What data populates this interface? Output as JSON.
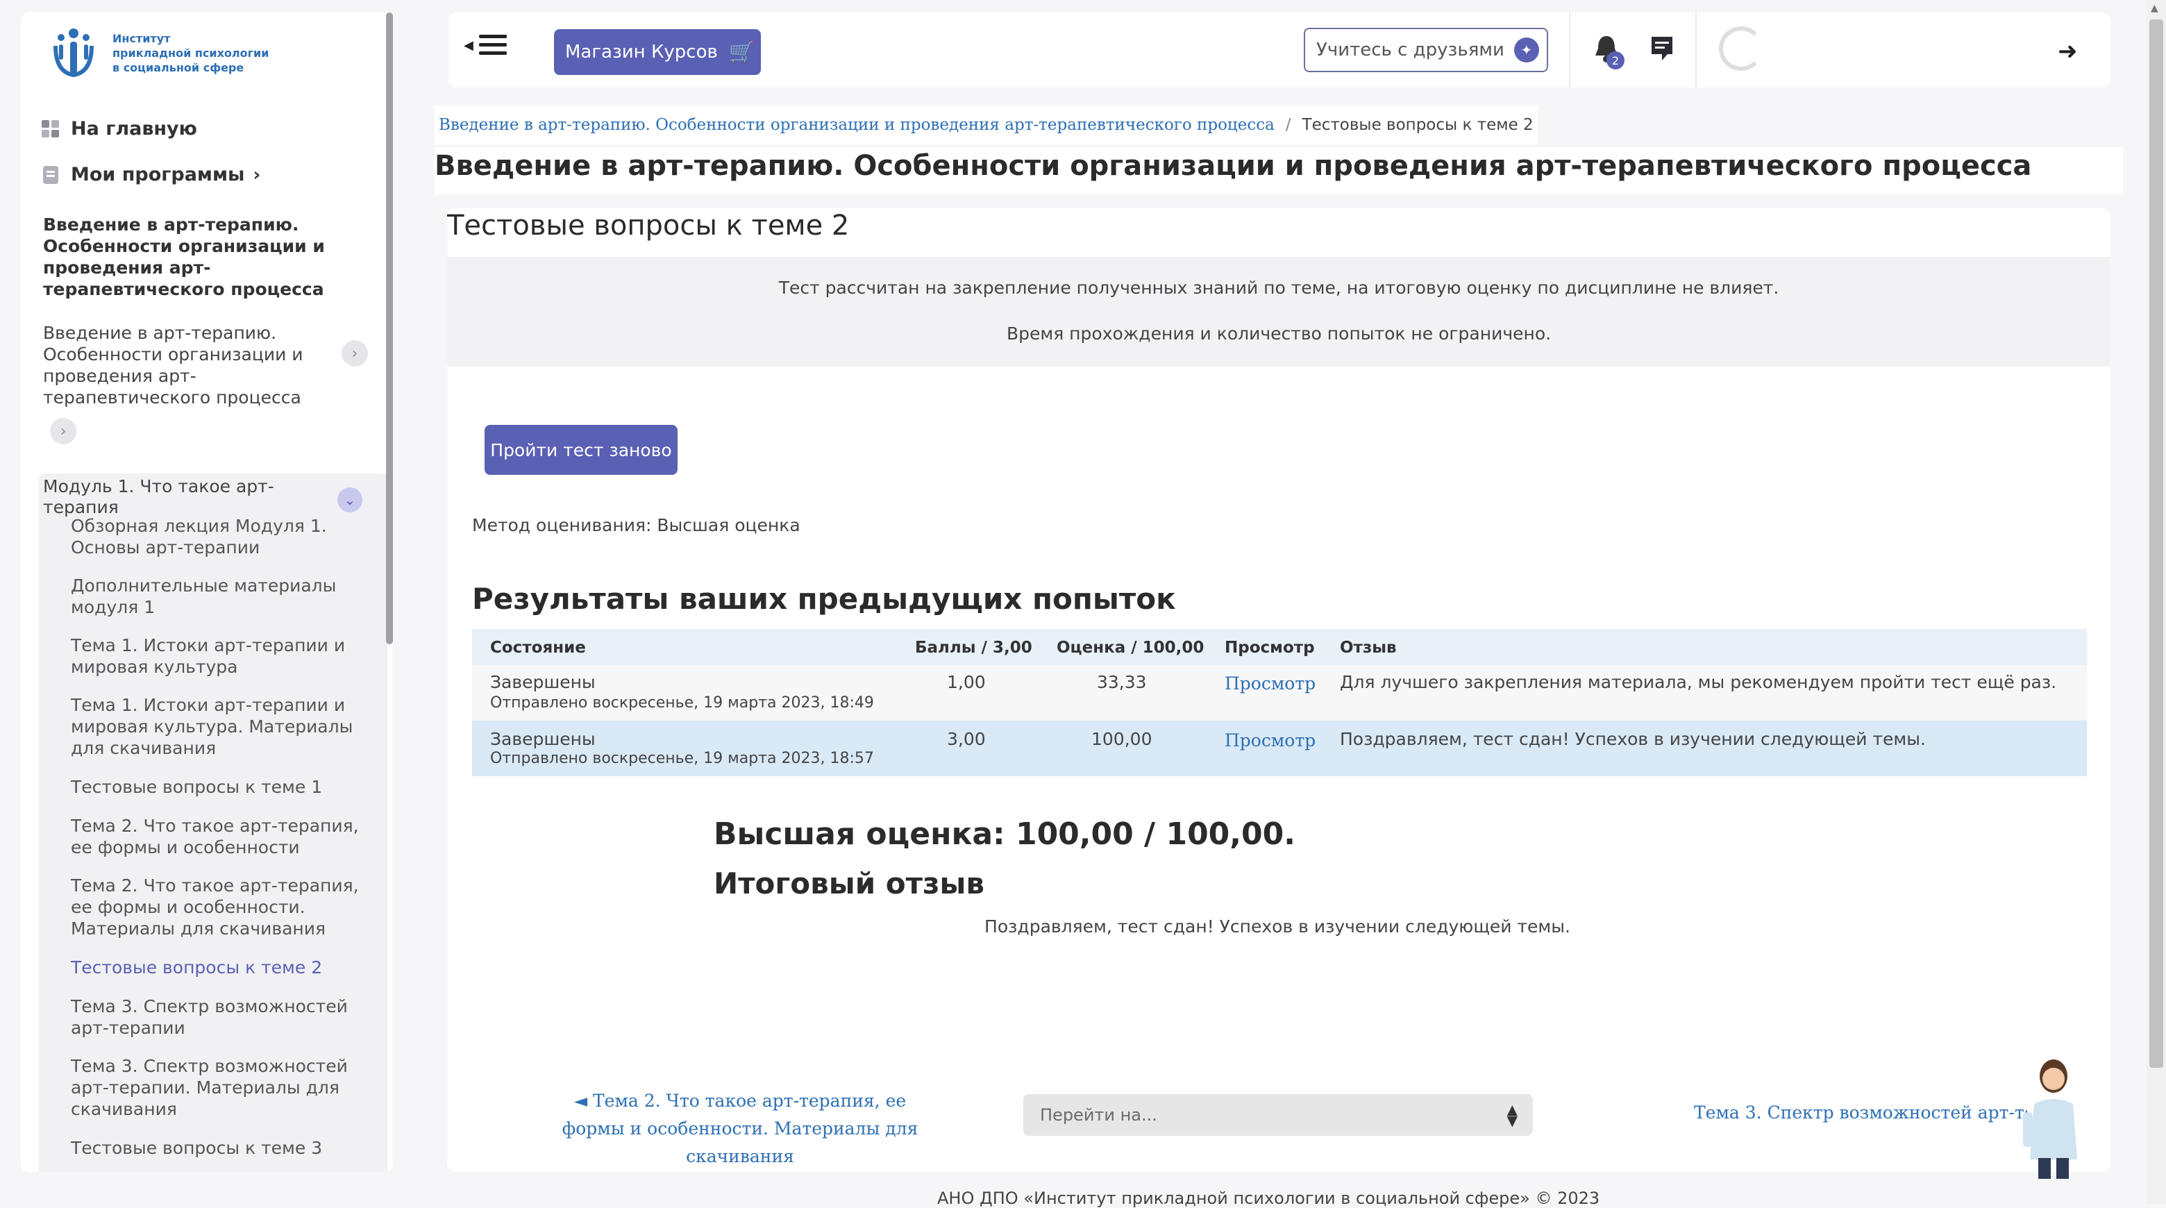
{
  "sidebar": {
    "logo_lines": [
      "Институт",
      "прикладной психологии",
      "в социальной сфере"
    ],
    "home_label": "На главную",
    "programs_label": "Мои программы",
    "course_title": "Введение в арт-терапию. Особенности организации и проведения арт-терапевтического процесса",
    "course_sub": "Введение в арт-терапию. Особенности организации и проведения арт-терапевтического процесса",
    "module_title": "Модуль 1. Что такое арт-терапия",
    "items": [
      {
        "label": "Обзорная лекция Модуля 1. Основы арт-терапии"
      },
      {
        "label": "Дополнительные материалы модуля 1"
      },
      {
        "label": "Тема 1. Истоки арт-терапии и мировая культура"
      },
      {
        "label": "Тема 1. Истоки арт-терапии и мировая культура. Материалы для скачивания"
      },
      {
        "label": "Тестовые вопросы к теме 1"
      },
      {
        "label": "Тема 2. Что такое арт-терапия, ее формы и особенности"
      },
      {
        "label": "Тема 2. Что такое арт-терапия, ее формы и особенности. Материалы для скачивания"
      },
      {
        "label": "Тестовые вопросы к теме 2",
        "active": true
      },
      {
        "label": "Тема 3. Спектр возможностей арт-терапии"
      },
      {
        "label": "Тема 3. Спектр возможностей арт-терапии. Материалы для скачивания"
      },
      {
        "label": "Тестовые вопросы к теме 3"
      }
    ]
  },
  "topbar": {
    "shop_label": "Магазин Курсов",
    "friends_label": "Учитесь с друзьями",
    "notif_count": "2"
  },
  "breadcrumb": {
    "course": "Введение в арт-терапию. Особенности организации и проведения арт-терапевтического процесса",
    "sep": "/",
    "current": "Тестовые вопросы к теме 2"
  },
  "page": {
    "title": "Введение в арт-терапию. Особенности организации и проведения арт-терапевтического процесса",
    "quiz_name": "Тестовые вопросы к теме 2",
    "intro1": "Тест рассчитан на закрепление полученных знаний по теме, на итоговую оценку по дисциплине не влияет.",
    "intro2": "Время прохождения и количество попыток не ограничено.",
    "retake_label": "Пройти тест заново",
    "grading_method": "Метод оценивания: Высшая оценка",
    "results_heading": "Результаты ваших предыдущих попыток",
    "table": {
      "headers": [
        "Состояние",
        "Баллы / 3,00",
        "Оценка / 100,00",
        "Просмотр",
        "Отзыв"
      ],
      "rows": [
        {
          "state": "Завершены",
          "submitted": "Отправлено воскресенье, 19 марта 2023, 18:49",
          "points": "1,00",
          "grade": "33,33",
          "review": "Просмотр",
          "feedback": "Для лучшего закрепления материала, мы рекомендуем пройти тест ещё раз."
        },
        {
          "state": "Завершены",
          "submitted": "Отправлено воскресенье, 19 марта 2023, 18:57",
          "points": "3,00",
          "grade": "100,00",
          "review": "Просмотр",
          "feedback": "Поздравляем, тест сдан! Успехов в изучении следующей темы."
        }
      ]
    },
    "best_grade": "Высшая оценка: 100,00 / 100,00.",
    "final_heading": "Итоговый отзыв",
    "final_text": "Поздравляем, тест сдан! Успехов в изучении следующей темы."
  },
  "nav": {
    "prev_label": "◄ Тема 2. Что такое арт-терапия, ее формы и особенности. Материалы для скачивания",
    "jump_placeholder": "Перейти на...",
    "next_label": "Тема 3. Спектр возможностей арт-терапии ►"
  },
  "footer": "АНО ДПО «Институт прикладной психологии в социальной сфере» © 2023",
  "colors": {
    "accent": "#5a60b3",
    "link": "#2d6fb5"
  }
}
